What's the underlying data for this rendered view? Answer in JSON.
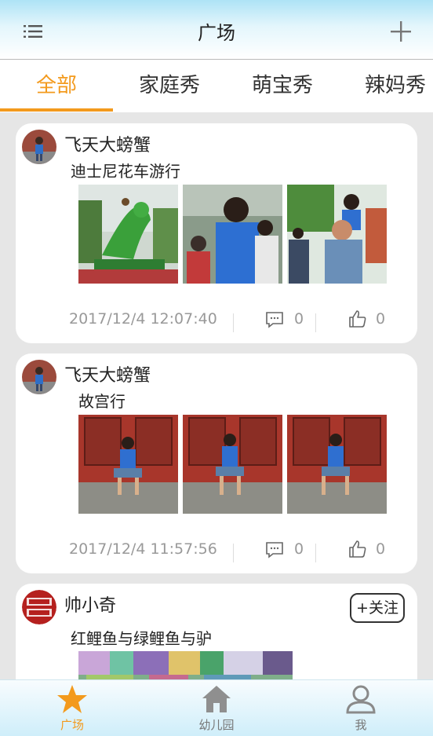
{
  "header": {
    "title": "广场",
    "menu_icon": "list-icon",
    "add_icon": "plus-icon"
  },
  "tabs": [
    {
      "label": "全部",
      "active": true
    },
    {
      "label": "家庭秀",
      "active": false
    },
    {
      "label": "萌宝秀",
      "active": false
    },
    {
      "label": "辣妈秀",
      "active": false
    }
  ],
  "posts": [
    {
      "author": "飞天大螃蟹",
      "text": "迪士尼花车游行",
      "time": "2017/12/4 12:07:40",
      "comments": "0",
      "likes": "0",
      "photos": [
        "parade-dinosaur",
        "crowd-boy-back",
        "father-son-shoulders"
      ]
    },
    {
      "author": "飞天大螃蟹",
      "text": "故宫行",
      "time": "2017/12/4 11:57:56",
      "comments": "0",
      "likes": "0",
      "photos": [
        "boy-red-wall",
        "boy-red-wall",
        "boy-red-wall"
      ]
    },
    {
      "author": "帅小奇",
      "text": "红鲤鱼与绿鲤鱼与驴",
      "follow": "+关注",
      "photos": [
        "colorful-pixels"
      ]
    }
  ],
  "bottom_nav": [
    {
      "label": "广场",
      "icon": "star-icon",
      "active": true
    },
    {
      "label": "幼儿园",
      "icon": "house-icon",
      "active": false
    },
    {
      "label": "我",
      "icon": "person-icon",
      "active": false
    }
  ],
  "colors": {
    "accent": "#f39a1d",
    "header_top": "#aee3f6",
    "bg": "#e6e6e6"
  }
}
